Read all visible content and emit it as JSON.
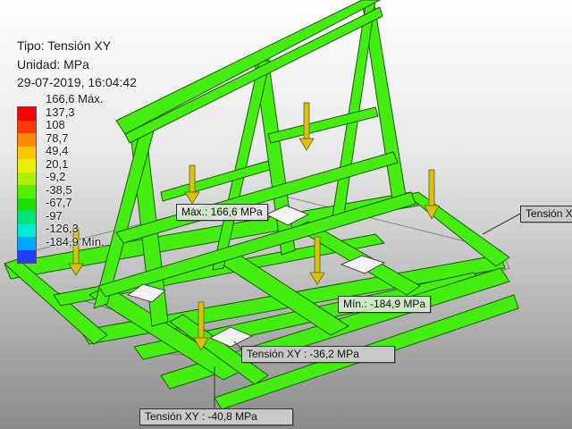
{
  "legend": {
    "type_label": "Tipo: Tensión XY",
    "unit_label": "Unidad: MPa",
    "timestamp": "29-07-2019, 16:04:42",
    "scale": [
      {
        "label": "166,6 Máx.",
        "color": "#ff0000"
      },
      {
        "label": "137,3",
        "color": "#ff3a00"
      },
      {
        "label": "108",
        "color": "#ff8c00"
      },
      {
        "label": "78,7",
        "color": "#ffc400"
      },
      {
        "label": "49,4",
        "color": "#e8f000"
      },
      {
        "label": "20,1",
        "color": "#a8f000"
      },
      {
        "label": "-9,2",
        "color": "#55ee00"
      },
      {
        "label": "-38,5",
        "color": "#1ee000"
      },
      {
        "label": "-67,7",
        "color": "#00e27a"
      },
      {
        "label": "-97",
        "color": "#00e8d8"
      },
      {
        "label": "-126,3",
        "color": "#00a8ff"
      },
      {
        "label": "-184,9 Mín.",
        "color": "#1f3fff"
      }
    ]
  },
  "probes": {
    "max_label": "Máx.: 166,6 MPa",
    "min_label": "Mín.: -184,9 MPa",
    "right_label": "Tensión XY",
    "mid_label": "Tensión XY : -36,2 MPa",
    "bottom_label": "Tensión XY : -40,8 MPa"
  },
  "colors": {
    "structure": "#44ee11",
    "edge": "#1d5a08",
    "load_arrow": "#d6c214",
    "pad": "#f2f2f2"
  }
}
